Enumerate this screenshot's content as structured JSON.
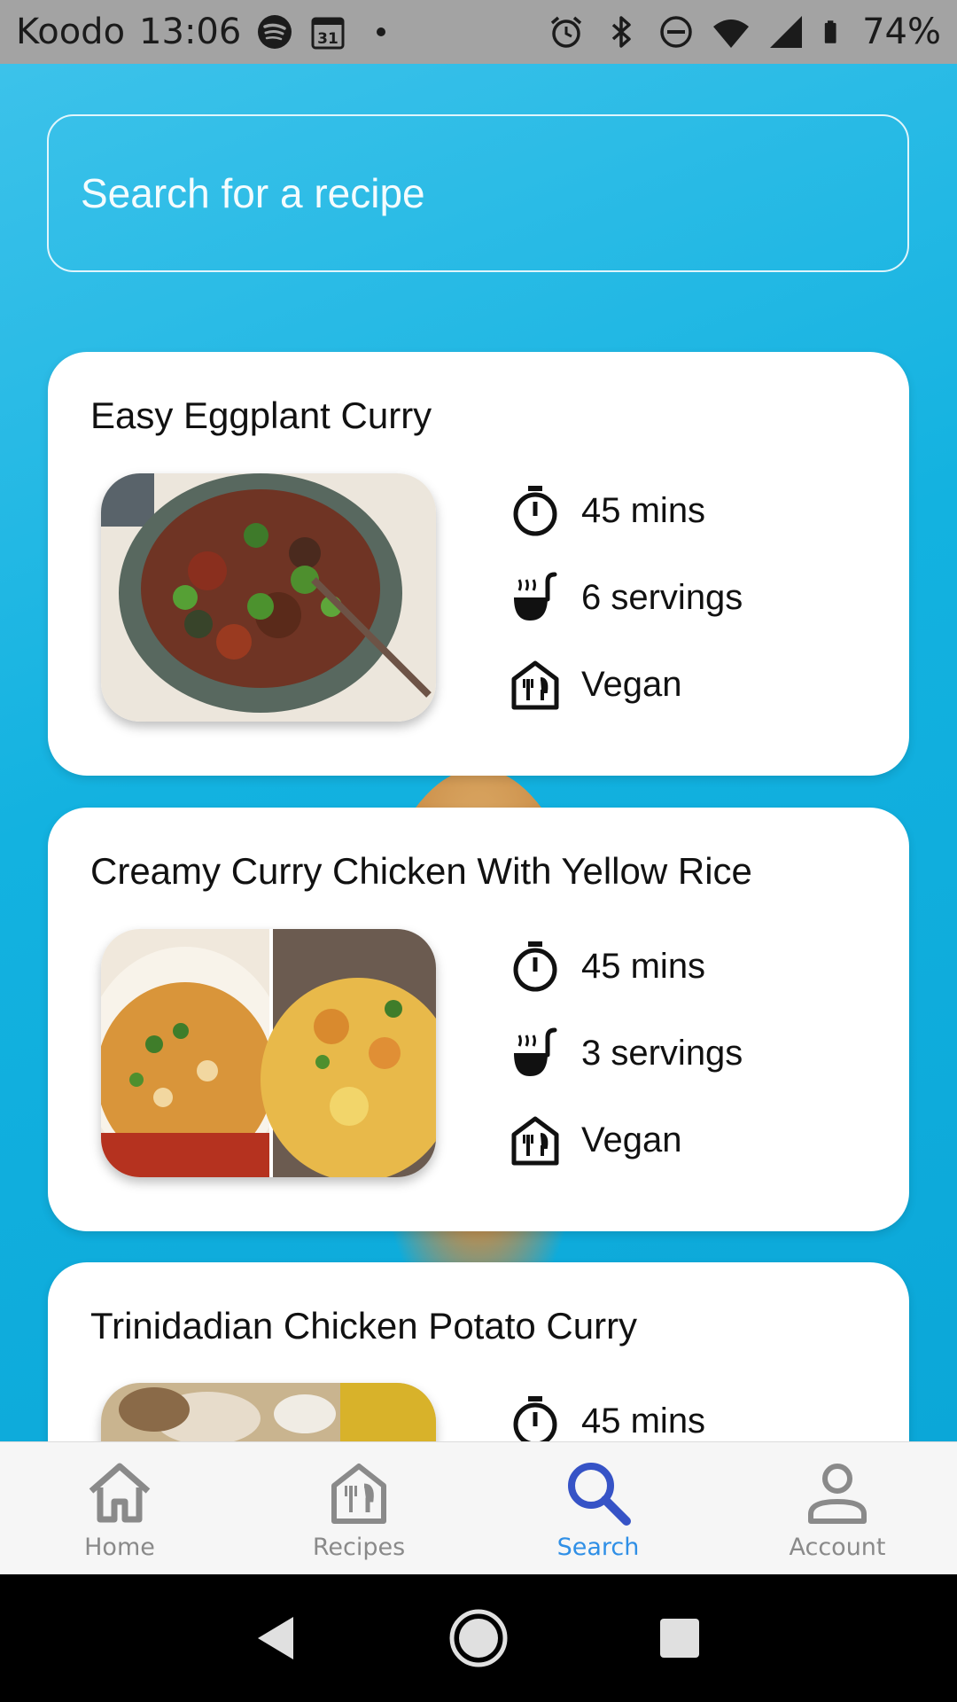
{
  "status_bar": {
    "carrier": "Koodo",
    "time": "13:06",
    "battery": "74%",
    "icons_left": [
      "spotify-icon",
      "calendar-31-icon",
      "dot-icon"
    ],
    "icons_right": [
      "alarm-icon",
      "bluetooth-icon",
      "dnd-icon",
      "wifi-icon",
      "signal-icon",
      "battery-icon"
    ],
    "calendar_day": "31"
  },
  "search": {
    "placeholder": "Search for a recipe",
    "value": ""
  },
  "recipes": [
    {
      "title": "Easy Eggplant Curry",
      "time": "45 mins",
      "servings": "6 servings",
      "diet": "Vegan"
    },
    {
      "title": "Creamy Curry Chicken With Yellow Rice",
      "time": "45 mins",
      "servings": "3 servings",
      "diet": "Vegan"
    },
    {
      "title": "Trinidadian Chicken Potato Curry",
      "time": "45 mins"
    }
  ],
  "bottom_nav": {
    "items": [
      {
        "label": "Home",
        "icon": "home-icon",
        "active": false
      },
      {
        "label": "Recipes",
        "icon": "recipes-icon",
        "active": false
      },
      {
        "label": "Search",
        "icon": "search-icon",
        "active": true
      },
      {
        "label": "Account",
        "icon": "account-icon",
        "active": false
      }
    ]
  },
  "colors": {
    "accent": "#2f8fe6",
    "background": "#13b2e0",
    "card": "#ffffff"
  }
}
